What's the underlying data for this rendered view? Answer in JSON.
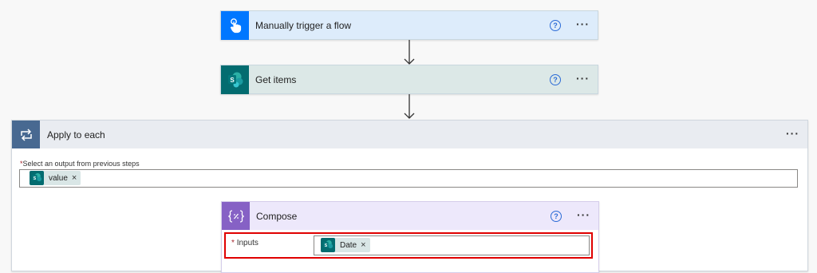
{
  "colors": {
    "trigger_accent": "#0077ff",
    "trigger_bg": "#ddecfb",
    "sharepoint_accent": "#036c70",
    "sharepoint_bg": "#dce8e7",
    "loop_accent": "#486991",
    "loop_bg": "#e9ecf1",
    "compose_accent": "#8661c5",
    "compose_bg": "#ede8fb",
    "highlight_border": "#e00000"
  },
  "trigger": {
    "title": "Manually trigger a flow",
    "icon": "touch-hand-icon"
  },
  "get_items": {
    "title": "Get items",
    "icon": "sharepoint-icon",
    "icon_letter": "S"
  },
  "apply_to_each": {
    "title": "Apply to each",
    "icon": "loop-icon",
    "select_label": "Select an output from previous steps",
    "token_label": "value"
  },
  "compose": {
    "title": "Compose",
    "icon": "braces-icon",
    "inputs_label": "Inputs",
    "token_label": "Date"
  },
  "common": {
    "help_glyph": "?",
    "more_glyph": "···",
    "required_mark": "*",
    "remove_glyph": "×"
  }
}
